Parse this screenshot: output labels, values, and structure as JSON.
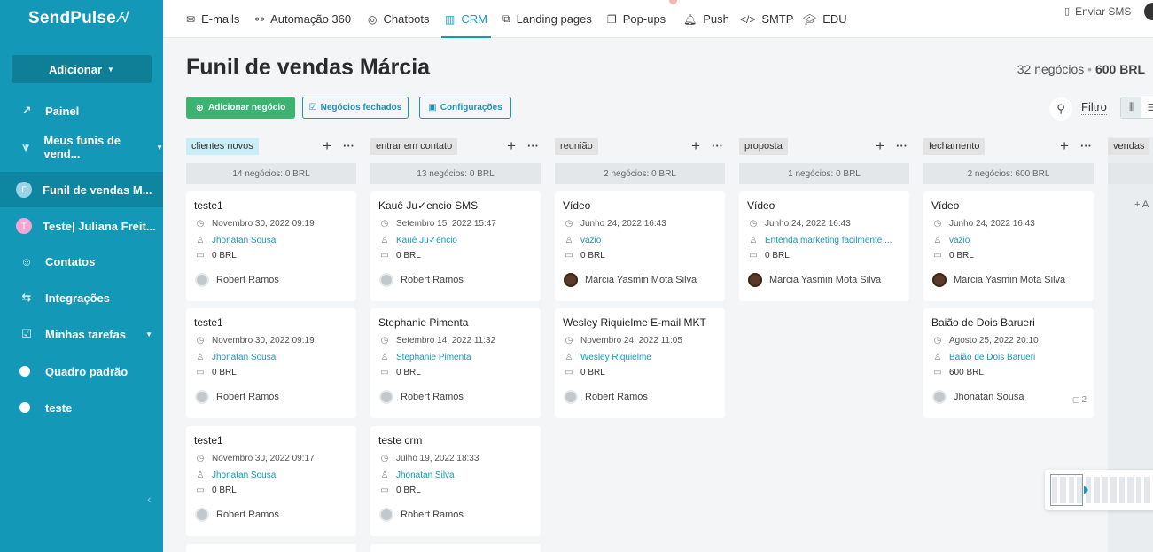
{
  "brand": {
    "logo": "SendPulse",
    "pulse_glyph": "⁄√"
  },
  "sidebar": {
    "add_button": "Adicionar",
    "items": [
      {
        "label": "Painel",
        "icon": "chart-line-icon",
        "glyph": "↗"
      },
      {
        "label": "Meus funis de vend...",
        "icon": "funnel-icon",
        "glyph": "⩛"
      },
      {
        "label": "Funil de vendas M...",
        "avatar": "F",
        "avatar_color": "#9ad3e6"
      },
      {
        "label": "Teste| Juliana Freit...",
        "avatar": "T",
        "avatar_color": "#f2a6d6"
      },
      {
        "label": "Contatos",
        "icon": "contacts-icon",
        "glyph": "☺"
      },
      {
        "label": "Integrações",
        "icon": "integrations-icon",
        "glyph": "⇆"
      },
      {
        "label": "Minhas tarefas",
        "icon": "tasks-icon",
        "glyph": "☑"
      },
      {
        "label": "Quadro padrão",
        "icon": "board-dot-icon"
      },
      {
        "label": "teste",
        "icon": "board-dot-icon"
      }
    ]
  },
  "topnav": {
    "items": [
      {
        "label": "E-mails",
        "glyph": "✉"
      },
      {
        "label": "Automação 360",
        "glyph": "⚯"
      },
      {
        "label": "Chatbots",
        "glyph": "◎"
      },
      {
        "label": "CRM",
        "glyph": "▥"
      },
      {
        "label": "Landing pages",
        "glyph": "⧉"
      },
      {
        "label": "Pop-ups",
        "glyph": "❐"
      },
      {
        "label": "Push",
        "glyph": "🔔︎"
      },
      {
        "label": "SMTP",
        "glyph": "</>"
      },
      {
        "label": "EDU",
        "glyph": "🎓︎"
      }
    ],
    "sms": "Enviar SMS",
    "sms_glyph": "▯"
  },
  "header": {
    "title": "Funil de vendas Márcia",
    "count": "32 negócios",
    "separator": "•",
    "amount": "600 BRL"
  },
  "actions": {
    "add_deal": "Adicionar negócio",
    "closed_deals": "Negócios fechados",
    "settings": "Configurações",
    "filter": "Filtro"
  },
  "columns": [
    {
      "stage": "clientes novos",
      "summary": "14 negócios: 0 BRL",
      "cards": [
        {
          "title": "teste1",
          "date": "Novembro 30, 2022 09:19",
          "contact": "Jhonatan Sousa",
          "amount": "0 BRL",
          "owner": "Robert Ramos"
        },
        {
          "title": "teste1",
          "date": "Novembro 30, 2022 09:19",
          "contact": "Jhonatan Sousa",
          "amount": "0 BRL",
          "owner": "Robert Ramos"
        },
        {
          "title": "teste1",
          "date": "Novembro 30, 2022 09:17",
          "contact": "Jhonatan Sousa",
          "amount": "0 BRL",
          "owner": "Robert Ramos"
        }
      ]
    },
    {
      "stage": "entrar em contato",
      "summary": "13 negócios: 0 BRL",
      "cards": [
        {
          "title": "Kauê Ju✓encio SMS",
          "date": "Setembro 15, 2022 15:47",
          "contact": "Kauê Ju✓encio",
          "amount": "0 BRL",
          "owner": "Robert Ramos"
        },
        {
          "title": "Stephanie Pimenta",
          "date": "Setembro 14, 2022 11:32",
          "contact": "Stephanie Pimenta",
          "amount": "0 BRL",
          "owner": "Robert Ramos"
        },
        {
          "title": "teste crm",
          "date": "Julho 19, 2022 18:33",
          "contact": "Jhonatan Silva",
          "amount": "0 BRL",
          "owner": "Robert Ramos"
        }
      ]
    },
    {
      "stage": "reunião",
      "summary": "2 negócios: 0 BRL",
      "cards": [
        {
          "title": "Vídeo",
          "date": "Junho 24, 2022 16:43",
          "contact": "vazio",
          "amount": "0 BRL",
          "owner": "Márcia Yasmin Mota Silva"
        },
        {
          "title": "Wesley Riquielme E-mail MKT",
          "date": "Novembro 24, 2022 11:05",
          "contact": "Wesley Riquielme",
          "amount": "0 BRL",
          "owner": "Robert Ramos"
        }
      ]
    },
    {
      "stage": "proposta",
      "summary": "1 negócios: 0 BRL",
      "cards": [
        {
          "title": "Vídeo",
          "date": "Junho 24, 2022 16:43",
          "contact": "Entenda marketing facilmente ...",
          "amount": "0 BRL",
          "owner": "Márcia Yasmin Mota Silva"
        }
      ]
    },
    {
      "stage": "fechamento",
      "summary": "2 negócios: 600 BRL",
      "cards": [
        {
          "title": "Vídeo",
          "date": "Junho 24, 2022 16:43",
          "contact": "vazio",
          "amount": "0 BRL",
          "owner": "Márcia Yasmin Mota Silva"
        },
        {
          "title": "Baião de Dois Barueri",
          "date": "Agosto 25, 2022 20:10",
          "contact": "Baião de Dois Barueri",
          "amount": "600 BRL",
          "owner": "Jhonatan Sousa",
          "comments": "2"
        }
      ]
    }
  ],
  "partial_column": {
    "stage": "vendas",
    "add_label": "+ A"
  },
  "colors": {
    "sidebar": "#1399b7",
    "accent": "#1399b7",
    "green": "#3cb371"
  }
}
